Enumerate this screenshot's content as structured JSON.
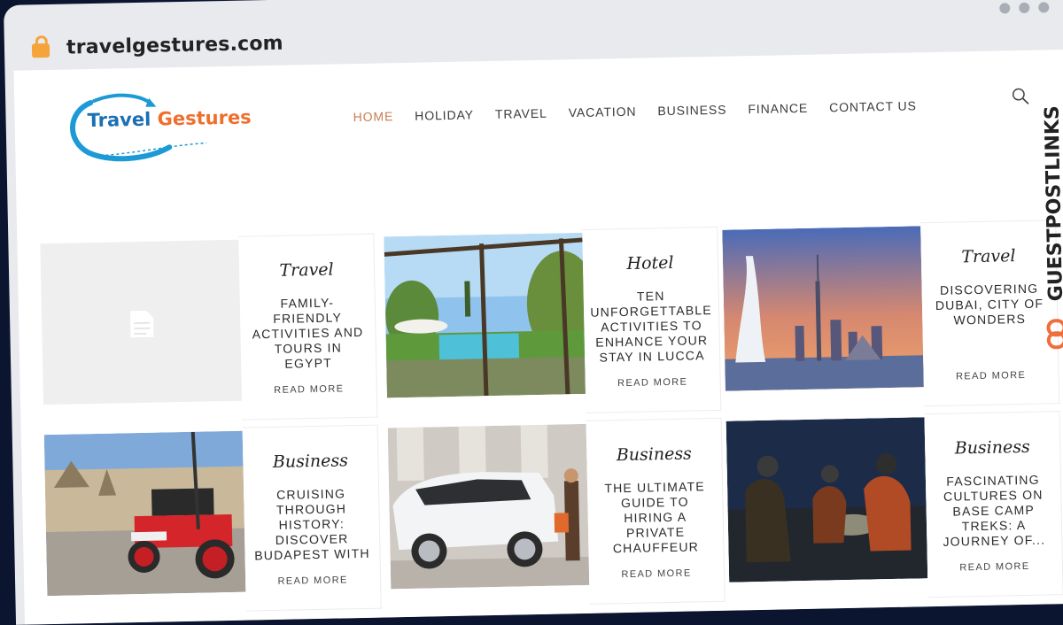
{
  "browser": {
    "url": "travelgestures.com"
  },
  "logo": {
    "word1": "Travel",
    "word2": "Gestures"
  },
  "nav": {
    "items": [
      "HOME",
      "HOLIDAY",
      "TRAVEL",
      "VACATION",
      "BUSINESS",
      "FINANCE",
      "CONTACT US"
    ],
    "active": "HOME"
  },
  "side_brand": {
    "text": "GUESTPOSTLINKS"
  },
  "posts": [
    {
      "category": "Travel",
      "title": "FAMILY-FRIENDLY ACTIVITIES AND TOURS IN EGYPT",
      "read_more": "READ MORE",
      "image": "placeholder-document-icon"
    },
    {
      "category": "Hotel",
      "title": "TEN UNFORGETTABLE ACTIVITIES TO ENHANCE YOUR STAY IN LUCCA",
      "read_more": "READ MORE",
      "image": "villa-pool-pergola"
    },
    {
      "category": "Travel",
      "title": "DISCOVERING DUBAI, CITY OF WONDERS",
      "read_more": "READ MORE",
      "image": "dubai-skyline-sunset"
    },
    {
      "category": "Business",
      "title": "CRUISING THROUGH HISTORY: DISCOVER BUDAPEST WITH CLASSIC CARS &...",
      "read_more": "READ MORE",
      "image": "red-classic-car-parliament"
    },
    {
      "category": "Business",
      "title": "THE ULTIMATE GUIDE TO HIRING A PRIVATE CHAUFFEUR SERVICE...",
      "read_more": "READ MORE",
      "image": "white-suv-chauffeur"
    },
    {
      "category": "Business",
      "title": "FASCINATING CULTURES ON BASE CAMP TREKS: A JOURNEY OF...",
      "read_more": "READ MORE",
      "image": "campers-night-glow"
    }
  ],
  "colors": {
    "accent": "#c77d52",
    "logo_blue": "#1b6fb3",
    "logo_orange": "#ef6f2c",
    "brand_orange": "#ef6f3c"
  }
}
